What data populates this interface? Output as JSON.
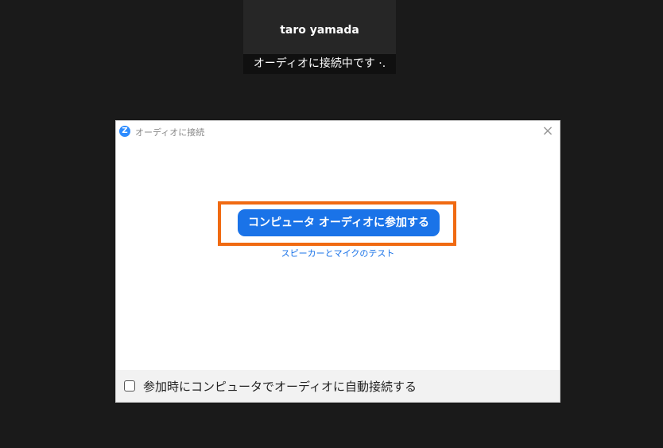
{
  "participant": {
    "name": "taro yamada",
    "status": "オーディオに接続中です ·."
  },
  "dialog": {
    "title": "オーディオに接続",
    "app_icon": "Z",
    "close_icon": "×",
    "join_button_label": "コンピュータ オーディオに参加する",
    "test_link_label": "スピーカーとマイクのテスト",
    "auto_connect_label": "参加時にコンピュータでオーディオに自動接続する",
    "auto_connect_checked": false
  },
  "colors": {
    "background": "#1a1a1a",
    "accent": "#1a73e8",
    "highlight": "#f06a12"
  }
}
